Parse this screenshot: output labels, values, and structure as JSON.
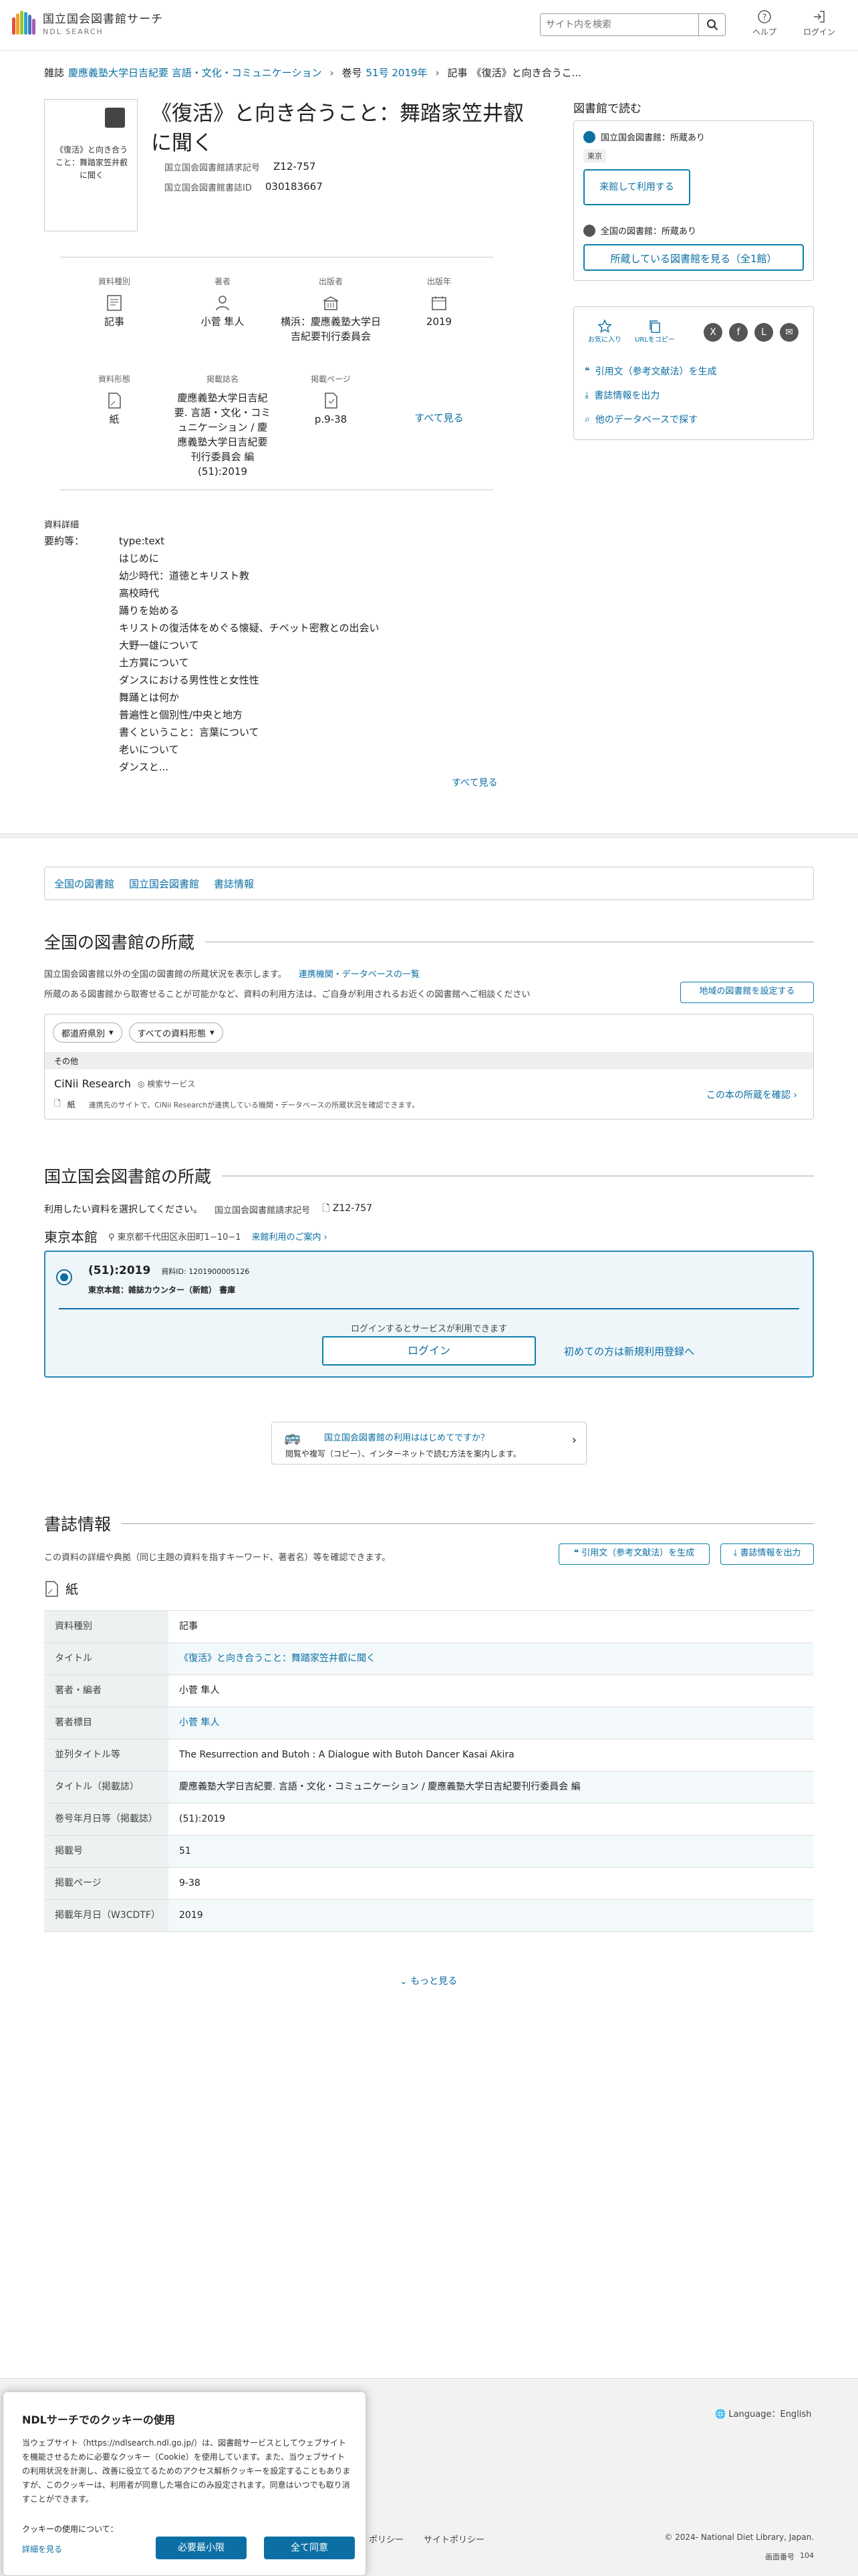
{
  "header": {
    "logo_line1": "国立国会図書館サーチ",
    "logo_line2": "NDL SEARCH",
    "search_placeholder": "サイト内を検索",
    "help_label": "ヘルプ",
    "login_label": "ログイン"
  },
  "breadcrumb": {
    "items": [
      "雑誌",
      "慶應義塾大学日吉紀要 言語・文化・コミュニケーション",
      "巻号",
      "51号 2019年",
      "記事",
      "《復活》と向き合うこ..."
    ]
  },
  "record": {
    "thumb_text": "《復活》と向き合うこと：舞踏家笠井叡に聞く",
    "title": "《復活》と向き合うこと：舞踏家笠井叡に聞く",
    "meta": [
      {
        "label": "国立国会図書館請求記号",
        "value": "Z12-757"
      },
      {
        "label": "国立国会図書館書誌ID",
        "value": "030183667"
      }
    ],
    "facets_row1": [
      {
        "label": "資料種別",
        "value": "記事"
      },
      {
        "label": "著者",
        "value": "小菅 隼人"
      },
      {
        "label": "出版者",
        "value": "横浜：慶應義塾大学日吉紀要刊行委員会"
      },
      {
        "label": "出版年",
        "value": "2019"
      }
    ],
    "facets_row2": [
      {
        "label": "資料形態",
        "value": "紙"
      },
      {
        "label": "掲載誌名",
        "value": "慶應義塾大学日吉紀要. 言語・文化・コミュニケーション / 慶應義塾大学日吉紀要刊行委員会 編 (51):2019"
      },
      {
        "label": "掲載ページ",
        "value": "p.9-38"
      }
    ],
    "see_all": "すべて見る"
  },
  "details": {
    "heading": "資料詳細",
    "summary_label": "要約等：",
    "summary_lines": [
      "type:text",
      "はじめに",
      "幼少時代：道徳とキリスト教",
      "高校時代",
      "踊りを始める",
      "キリストの復活体をめぐる懐疑、チベット密教との出会い",
      "大野一雄について",
      "土方巽について",
      "ダンスにおける男性性と女性性",
      "舞踊とは何か",
      "普遍性と個別性/中央と地方",
      "書くということ：言葉について",
      "老いについて",
      "ダンスと..."
    ],
    "see_all": "すべて見る"
  },
  "right_panel": {
    "heading": "図書館で読む",
    "ndl_status": "国立国会図書館：所蔵あり",
    "location_tag": "東京",
    "visit_button": "来館して利用する",
    "all_status": "全国の図書館：所蔵あり",
    "holding_button": "所蔵している図書館を見る（全1館）",
    "favorite_label": "お気に入り",
    "copy_url_label": "URLをコピー",
    "share_icons": [
      "X",
      "f",
      "L",
      "✉"
    ],
    "links": [
      "引用文（参考文献法）を生成",
      "書誌情報を出力",
      "他のデータベースで探す"
    ]
  },
  "tabs": [
    "全国の図書館",
    "国立国会図書館",
    "書誌情報"
  ],
  "national": {
    "heading": "全国の図書館の所蔵",
    "desc1": "国立国会図書館以外の全国の図書館の所蔵状況を表示します。",
    "desc1_link": "連携機関・データベースの一覧",
    "desc2": "所蔵のある図書館から取寄せることが可能かなど、資料の利用方法は、ご自身が利用されるお近くの図書館へご相談ください",
    "region_button": "地域の図書館を設定する",
    "filter1": "都道府県別",
    "filter2": "すべての資料形態",
    "other_label": "その他",
    "cinii_name": "CiNii Research",
    "cinii_badge": "検索サービス",
    "cinii_form": "紙",
    "cinii_desc": "連携先のサイトで、CiNii Researchが連携している機関・データベースの所蔵状況を確認できます。",
    "cinii_link": "この本の所蔵を確認"
  },
  "ndl": {
    "heading": "国立国会図書館の所蔵",
    "instruction": "利用したい資料を選択してください。",
    "callno_label": "国立国会図書館請求記号",
    "callno": "Z12-757",
    "branch": "東京本館",
    "address": "東京都千代田区永田町1−10−1",
    "guide_link": "来館利用のご案内",
    "item_vol": "(51):2019",
    "item_id": "資料ID: 1201900005126",
    "item_loc": "東京本館：雑誌カウンター（新館） 書庫",
    "login_prompt": "ログインするとサービスが利用できます",
    "login_button": "ログイン",
    "register_link": "初めての方は新規利用登録へ",
    "guide_title": "国立国会図書館の利用ははじめてですか？",
    "guide_desc": "閲覧や複写（コピー）、インターネットで読む方法を案内します。"
  },
  "biblio": {
    "heading": "書誌情報",
    "desc": "この資料の詳細や典拠（同じ主題の資料を指すキーワード、著者名）等を確認できます。",
    "cite_button": "引用文（参考文献法）を生成",
    "export_button": "書誌情報を出力",
    "form_label": "紙",
    "rows": [
      {
        "k": "資料種別",
        "v": "記事"
      },
      {
        "k": "タイトル",
        "v": "《復活》と向き合うこと：舞踏家笠井叡に聞く"
      },
      {
        "k": "著者・編者",
        "v": "小菅 隼人"
      },
      {
        "k": "著者標目",
        "v": "小菅 隼人"
      },
      {
        "k": "並列タイトル等",
        "v": "The Resurrection and Butoh : A Dialogue with Butoh Dancer Kasai Akira"
      },
      {
        "k": "タイトル（掲載誌）",
        "v": "慶應義塾大学日吉紀要. 言語・文化・コミュニケーション / 慶應義塾大学日吉紀要刊行委員会 編"
      },
      {
        "k": "巻号年月日等（掲載誌）",
        "v": "(51):2019"
      },
      {
        "k": "掲載号",
        "v": "51"
      },
      {
        "k": "掲載ページ",
        "v": "9-38"
      },
      {
        "k": "掲載年月日（W3CDTF）",
        "v": "2019"
      }
    ],
    "more": "もっと見る"
  },
  "footer": {
    "language": "Language：English",
    "policy1": "ポリシー",
    "policy2": "サイトポリシー",
    "copyright": "© 2024- National Diet Library, Japan.",
    "screen_no_label": "画面番号",
    "screen_no": "104"
  },
  "cookie": {
    "title": "NDLサーチでのクッキーの使用",
    "body": "当ウェブサイト（https://ndlsearch.ndl.go.jp/）は、図書館サービスとしてウェブサイトを機能させるために必要なクッキー（Cookie）を使用しています。また、当ウェブサイトの利用状況を計測し、改善に役立てるためのアクセス解析クッキーを設定することもありますが、このクッキーは、利用者が同意した場合にのみ設定されます。同意はいつでも取り消すことができます。",
    "about": "クッキーの使用について：",
    "detail_link": "詳細を見る",
    "min_button": "必要最小限",
    "all_button": "全て同意"
  },
  "colors": {
    "link": "#0b6fa4",
    "accent": "#0b7fab",
    "table_header": "#eef1f2"
  }
}
